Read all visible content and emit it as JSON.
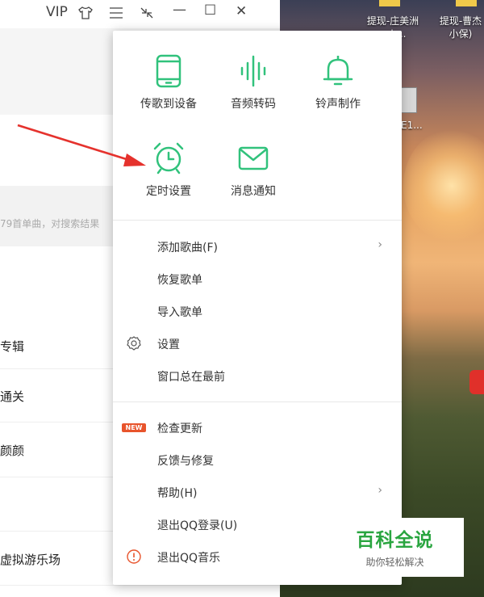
{
  "desktop": {
    "icon1_label_l1": "提现-庄美洲",
    "icon1_label_l2": "nsh...",
    "icon2_label_l1": "提现-曹杰",
    "icon2_label_l2": "小保)",
    "icon3_label": "E1..."
  },
  "titlebar": {
    "vip": "VIP",
    "skin_icon": "shirt-icon",
    "menu_icon": "menu-icon",
    "mini_icon": "mini-mode-icon",
    "minimize": "—",
    "maximize": "☐",
    "close": "✕"
  },
  "app": {
    "search_hint": "79首单曲，对搜索结果",
    "items": [
      "专辑",
      "通关",
      "颜颜",
      "虚拟游乐场"
    ]
  },
  "menu": {
    "features": [
      {
        "label": "传歌到设备",
        "icon": "phone-icon"
      },
      {
        "label": "音频转码",
        "icon": "waveform-icon"
      },
      {
        "label": "铃声制作",
        "icon": "bell-icon"
      },
      {
        "label": "定时设置",
        "icon": "alarm-clock-icon"
      },
      {
        "label": "消息通知",
        "icon": "envelope-icon"
      }
    ],
    "items": [
      {
        "label": "添加歌曲(F)",
        "chevron": "›"
      },
      {
        "label": "恢复歌单"
      },
      {
        "label": "导入歌单"
      },
      {
        "label": "设置",
        "icon": "gear-icon"
      },
      {
        "label": "窗口总在最前"
      },
      {
        "label": "检查更新",
        "badge": "NEW"
      },
      {
        "label": "反馈与修复"
      },
      {
        "label": "帮助(H)",
        "chevron": "›"
      },
      {
        "label": "退出QQ登录(U)"
      },
      {
        "label": "退出QQ音乐",
        "icon": "exit-icon"
      }
    ],
    "accent": "#31c27c"
  },
  "watermark": {
    "title": "百科全说",
    "subtitle": "助你轻松解决"
  }
}
